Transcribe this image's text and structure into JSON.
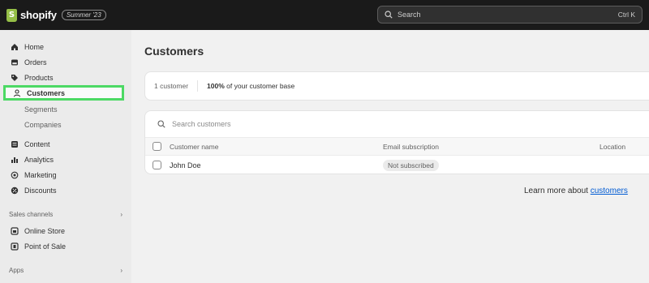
{
  "topbar": {
    "logo_mark": "S",
    "logo_text": "shopify",
    "edition": "Summer '23",
    "search_placeholder": "Search",
    "search_shortcut": "Ctrl K"
  },
  "sidebar": {
    "items": [
      {
        "label": "Home",
        "icon": "home-icon"
      },
      {
        "label": "Orders",
        "icon": "orders-icon"
      },
      {
        "label": "Products",
        "icon": "tag-icon"
      },
      {
        "label": "Customers",
        "icon": "person-icon",
        "active": true
      },
      {
        "label": "Segments"
      },
      {
        "label": "Companies"
      },
      {
        "label": "Content",
        "icon": "content-icon"
      },
      {
        "label": "Analytics",
        "icon": "bar-chart-icon"
      },
      {
        "label": "Marketing",
        "icon": "target-icon"
      },
      {
        "label": "Discounts",
        "icon": "discount-icon"
      }
    ],
    "sales_channels_label": "Sales channels",
    "channels": [
      {
        "label": "Online Store",
        "icon": "store-icon"
      },
      {
        "label": "Point of Sale",
        "icon": "pos-icon"
      }
    ],
    "apps_label": "Apps",
    "chevron": "›",
    "active_outline_color": "#4cd964"
  },
  "main": {
    "title": "Customers",
    "stats": {
      "count": "1 customer",
      "base_bold": "100%",
      "base_rest": " of your customer base"
    },
    "table": {
      "search_placeholder": "Search customers",
      "columns": [
        "Customer name",
        "Email subscription",
        "Location"
      ],
      "rows": [
        {
          "name": "John Doe",
          "email_subscription": "Not subscribed",
          "location": ""
        }
      ]
    },
    "learn_more_prefix": "Learn more about ",
    "learn_more_link": "customers"
  }
}
